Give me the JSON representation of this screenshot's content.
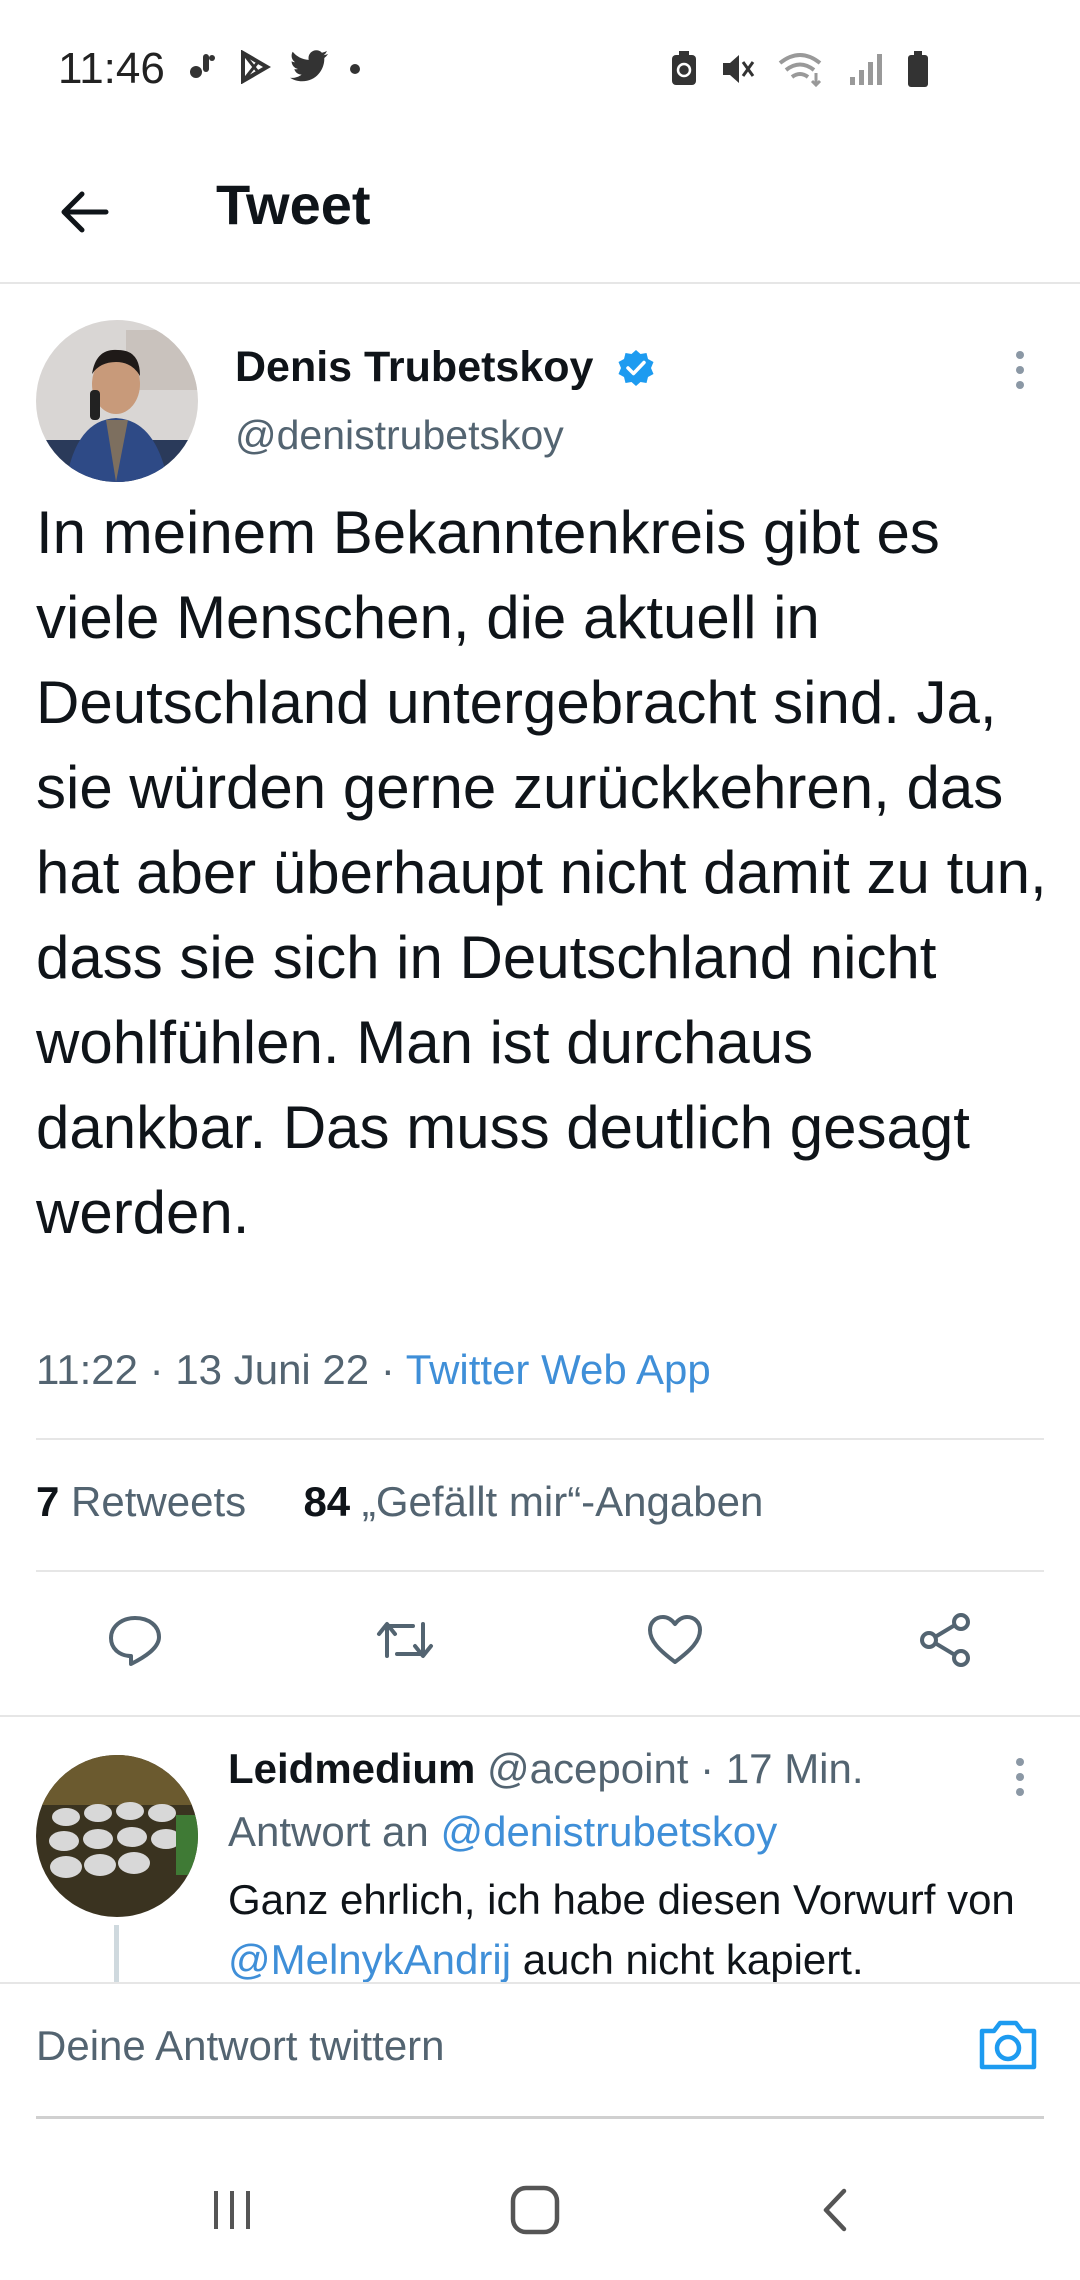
{
  "status_bar": {
    "time": "11:46",
    "left_icons": [
      "voicemail-icon",
      "play-store-icon",
      "twitter-icon",
      "dot-icon"
    ],
    "right_icons": [
      "battery-saver-icon",
      "mute-icon",
      "wifi-icon",
      "signal-icon",
      "battery-icon"
    ]
  },
  "header": {
    "title": "Tweet",
    "back_icon": "arrow-left-icon"
  },
  "tweet": {
    "author_name": "Denis Trubetskoy",
    "verified": true,
    "handle": "@denistrubetskoy",
    "text": "In meinem Bekanntenkreis gibt es viele Menschen, die aktuell in Deutschland untergebracht sind. Ja, sie würden gerne zurückkehren, das hat aber überhaupt nicht damit zu tun, dass sie sich in Deutschland nicht wohlfühlen. Man ist durchaus dankbar. Das muss deutlich gesagt werden.",
    "time": "11:22",
    "date": "13 Juni 22",
    "source": "Twitter Web App",
    "retweets_count": "7",
    "retweets_label": "Retweets",
    "likes_count": "84",
    "likes_label": "„Gefällt mir“-Angaben",
    "actions": [
      "reply-icon",
      "retweet-icon",
      "like-icon",
      "share-icon"
    ]
  },
  "reply": {
    "author_name": "Leidmedium",
    "handle": "@acepoint",
    "age": "17 Min.",
    "reply_to_prefix": "Antwort an",
    "reply_to_handle": "@denistrubetskoy",
    "text_part1": "Ganz ehrlich, ich habe diesen Vorwurf von",
    "mention": "@MelnykAndrij",
    "text_part2": "auch nicht kapiert."
  },
  "compose": {
    "placeholder": "Deine Antwort twittern",
    "camera_icon": "camera-icon"
  },
  "nav_bar": {
    "buttons": [
      "recents-icon",
      "home-icon",
      "back-icon"
    ]
  },
  "colors": {
    "accent": "#1d9bf0",
    "text": "#0f1419",
    "secondary": "#536471",
    "divider": "#e6e6e6"
  }
}
